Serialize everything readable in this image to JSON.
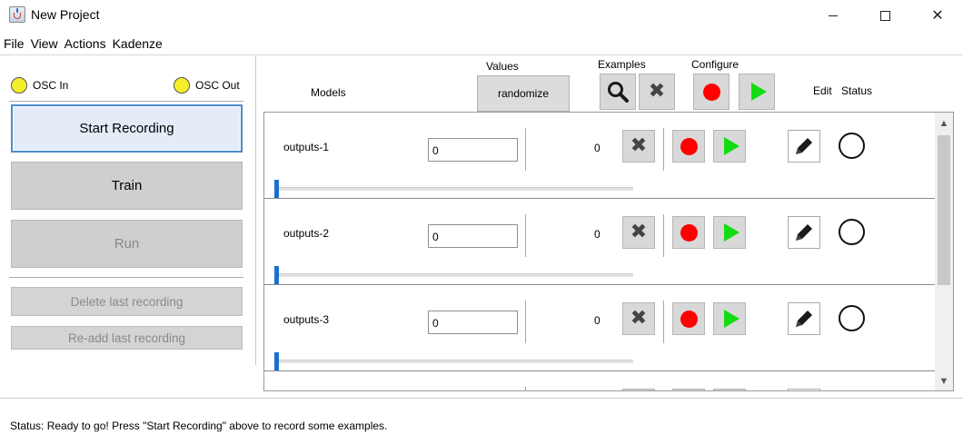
{
  "window": {
    "title": "New Project",
    "minimize_glyph": "—",
    "close_glyph": "✕"
  },
  "menu": [
    {
      "label": "File"
    },
    {
      "label": "View"
    },
    {
      "label": "Actions"
    },
    {
      "label": "Kadenze"
    }
  ],
  "osc": {
    "in_label": "OSC In",
    "out_label": "OSC Out",
    "led_color": "#f5ef2a"
  },
  "buttons": {
    "start_recording": "Start Recording",
    "train": "Train",
    "run": "Run",
    "delete_last": "Delete last recording",
    "readd_last": "Re-add last recording",
    "randomize": "randomize"
  },
  "headers": {
    "models": "Models",
    "values": "Values",
    "examples": "Examples",
    "configure": "Configure",
    "edit": "Edit",
    "status": "Status"
  },
  "rows": [
    {
      "name": "outputs-1",
      "value": "0",
      "count": "0"
    },
    {
      "name": "outputs-2",
      "value": "0",
      "count": "0"
    },
    {
      "name": "outputs-3",
      "value": "0",
      "count": "0"
    }
  ],
  "icons": {
    "search": "search-icon",
    "clear": "clear-icon",
    "record": "record-icon",
    "play": "play-icon",
    "edit": "pencil-icon",
    "status": "status-circle-icon",
    "scroll_up": "▲",
    "scroll_down": "▼"
  },
  "colors": {
    "record": "#ff0000",
    "play": "#12dc12",
    "focus_border": "#4a8bd0",
    "slider": "#1a6fd0"
  },
  "status_bar": "Status:  Ready to go! Press \"Start Recording\" above to record some examples."
}
